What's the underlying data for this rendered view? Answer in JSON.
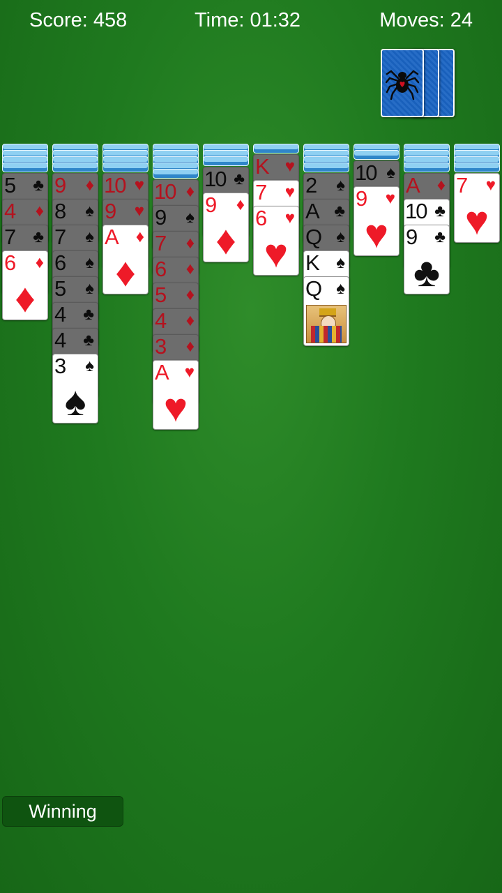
{
  "hud": {
    "score": "Score: 458",
    "time": "Time: 01:32",
    "moves": "Moves: 24"
  },
  "stock": {
    "icon": "spider-icon",
    "back_color": "#1a64c3"
  },
  "colors": {
    "felt": "#1f7a1f",
    "red_suit": "#ee1a28",
    "black_suit": "#111111",
    "card_back": "#8fd0f2"
  },
  "tableau": [
    {
      "face_down": 4,
      "face_up": [
        {
          "rank": "5",
          "suit": "♣",
          "color": "black",
          "dim": true
        },
        {
          "rank": "4",
          "suit": "♦",
          "color": "red",
          "dim": true
        },
        {
          "rank": "7",
          "suit": "♣",
          "color": "black",
          "dim": true
        },
        {
          "rank": "6",
          "suit": "♦",
          "color": "red",
          "dim": false
        }
      ]
    },
    {
      "face_down": 4,
      "face_up": [
        {
          "rank": "9",
          "suit": "♦",
          "color": "red",
          "dim": true
        },
        {
          "rank": "8",
          "suit": "♠",
          "color": "black",
          "dim": true
        },
        {
          "rank": "7",
          "suit": "♠",
          "color": "black",
          "dim": true
        },
        {
          "rank": "6",
          "suit": "♠",
          "color": "black",
          "dim": true
        },
        {
          "rank": "5",
          "suit": "♠",
          "color": "black",
          "dim": true
        },
        {
          "rank": "4",
          "suit": "♣",
          "color": "black",
          "dim": true
        },
        {
          "rank": "4",
          "suit": "♣",
          "color": "black",
          "dim": true
        },
        {
          "rank": "3",
          "suit": "♠",
          "color": "black",
          "dim": false
        }
      ]
    },
    {
      "face_down": 4,
      "face_up": [
        {
          "rank": "10",
          "suit": "♥",
          "color": "red",
          "dim": true
        },
        {
          "rank": "9",
          "suit": "♥",
          "color": "red",
          "dim": true
        },
        {
          "rank": "A",
          "suit": "♦",
          "color": "red",
          "dim": false
        }
      ]
    },
    {
      "face_down": 5,
      "face_up": [
        {
          "rank": "10",
          "suit": "♦",
          "color": "red",
          "dim": true
        },
        {
          "rank": "9",
          "suit": "♠",
          "color": "black",
          "dim": true
        },
        {
          "rank": "7",
          "suit": "♦",
          "color": "red",
          "dim": true
        },
        {
          "rank": "6",
          "suit": "♦",
          "color": "red",
          "dim": true
        },
        {
          "rank": "5",
          "suit": "♦",
          "color": "red",
          "dim": true
        },
        {
          "rank": "4",
          "suit": "♦",
          "color": "red",
          "dim": true
        },
        {
          "rank": "3",
          "suit": "♦",
          "color": "red",
          "dim": true
        },
        {
          "rank": "A",
          "suit": "♥",
          "color": "red",
          "dim": false
        }
      ]
    },
    {
      "face_down": 3,
      "face_up": [
        {
          "rank": "10",
          "suit": "♣",
          "color": "black",
          "dim": true
        },
        {
          "rank": "9",
          "suit": "♦",
          "color": "red",
          "dim": false
        }
      ]
    },
    {
      "face_down": 1,
      "face_up": [
        {
          "rank": "K",
          "suit": "♥",
          "color": "red",
          "dim": true
        },
        {
          "rank": "7",
          "suit": "♥",
          "color": "red",
          "dim": false
        },
        {
          "rank": "6",
          "suit": "♥",
          "color": "red",
          "dim": false
        }
      ]
    },
    {
      "face_down": 4,
      "face_up": [
        {
          "rank": "2",
          "suit": "♠",
          "color": "black",
          "dim": true
        },
        {
          "rank": "A",
          "suit": "♣",
          "color": "black",
          "dim": true
        },
        {
          "rank": "Q",
          "suit": "♠",
          "color": "black",
          "dim": true
        },
        {
          "rank": "K",
          "suit": "♠",
          "color": "black",
          "dim": false
        },
        {
          "rank": "Q",
          "suit": "♠",
          "color": "black",
          "dim": false,
          "court": true
        }
      ]
    },
    {
      "face_down": 2,
      "face_up": [
        {
          "rank": "10",
          "suit": "♠",
          "color": "black",
          "dim": true
        },
        {
          "rank": "9",
          "suit": "♥",
          "color": "red",
          "dim": false
        }
      ]
    },
    {
      "face_down": 4,
      "face_up": [
        {
          "rank": "A",
          "suit": "♦",
          "color": "red",
          "dim": true
        },
        {
          "rank": "10",
          "suit": "♣",
          "color": "black",
          "dim": false
        },
        {
          "rank": "9",
          "suit": "♣",
          "color": "black",
          "dim": false
        }
      ]
    },
    {
      "face_down": 4,
      "face_up": [
        {
          "rank": "7",
          "suit": "♥",
          "color": "red",
          "dim": false
        }
      ]
    }
  ],
  "footer": {
    "winning_label": "Winning"
  }
}
